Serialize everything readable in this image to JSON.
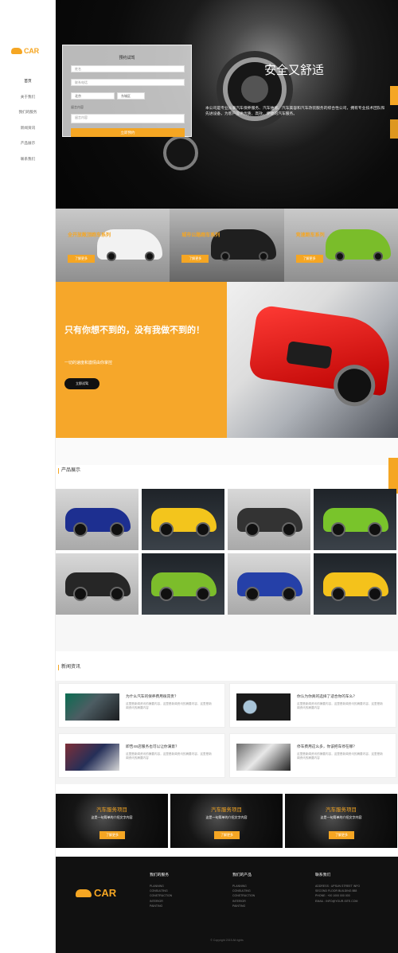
{
  "brand": {
    "name": "CAR"
  },
  "nav": [
    "首页",
    "关于我们",
    "我们的服务",
    "新闻资讯",
    "产品展示",
    "联系我们"
  ],
  "hero": {
    "title": "安全又舒适",
    "description": "本公司是专业从事汽车保养服务、汽车维修、汽车美容和汽车改装服务的综合性公司，拥有专业技术团队和先进设备，为客户提供优质、高效、便捷的汽车服务。"
  },
  "form": {
    "title": "预约试驾",
    "name_placeholder": "姓名",
    "phone_placeholder": "联系电话",
    "province": "北京",
    "city": "东城区",
    "label": "留言内容",
    "message_placeholder": "留言内容",
    "button": "立即预约"
  },
  "series": [
    {
      "title": "全开放敞顶跑车系列",
      "button": "了解更多"
    },
    {
      "title": "城市公路跑车系列",
      "button": "了解更多"
    },
    {
      "title": "竞速跑车系列",
      "button": "了解更多"
    }
  ],
  "banner": {
    "title": "只有你想不到的，没有我做不到的！",
    "subtitle": "一切的速度和激情由你掌控",
    "button": "立即试驾"
  },
  "products": {
    "title": "产品展示"
  },
  "news": {
    "title": "新闻资讯",
    "items": [
      {
        "title": "为什么汽车的保养费用很昂贵？",
        "desc": "这里是新闻资讯的摘要内容，这里是新闻资讯的摘要内容，这里是新闻资讯的摘要内容"
      },
      {
        "title": "你认为你真的选择了适合你的车么？",
        "desc": "这里是新闻资讯的摘要内容，这里是新闻资讯的摘要内容，这里是新闻资讯的摘要内容"
      },
      {
        "title": "即告4S店服务也可以让你满意？",
        "desc": "这里是新闻资讯的摘要内容，这里是新闻资讯的摘要内容，这里是新闻资讯的摘要内容"
      },
      {
        "title": "停车费用这么多，你该把车停在哪？",
        "desc": "这里是新闻资讯的摘要内容，这里是新闻资讯的摘要内容，这里是新闻资讯的摘要内容"
      }
    ]
  },
  "services": [
    {
      "title": "汽车服务项目",
      "sub": "这是一句简单的介绍文字内容",
      "button": "了解更多"
    },
    {
      "title": "汽车服务项目",
      "sub": "这是一句简单的介绍文字内容",
      "button": "了解更多"
    },
    {
      "title": "汽车服务项目",
      "sub": "这是一句简单的介绍文字内容",
      "button": "了解更多"
    }
  ],
  "footer": {
    "col1": {
      "title": "我们的服务",
      "lines": [
        "PLANNING",
        "CONSULTING",
        "CONSTRUCTION",
        "INTERIOR",
        "PAINTING"
      ]
    },
    "col2": {
      "title": "我们的产品",
      "lines": [
        "PLANNING",
        "CONSULTING",
        "CONSTRUCTION",
        "INTERIOR",
        "PAINTING"
      ]
    },
    "col3": {
      "title": "联系我们",
      "lines": [
        "ADDRESS : UPSUN STREET INFO",
        "SECOND FLOOR BUILDING 888",
        "PHONE : +00 1000 000 000",
        "EMAIL : INFO@YOUR-SITE.COM"
      ]
    },
    "copyright": "© Copyright 2015 All rights"
  },
  "colors": {
    "accent": "#f5a623",
    "dark": "#111111"
  }
}
